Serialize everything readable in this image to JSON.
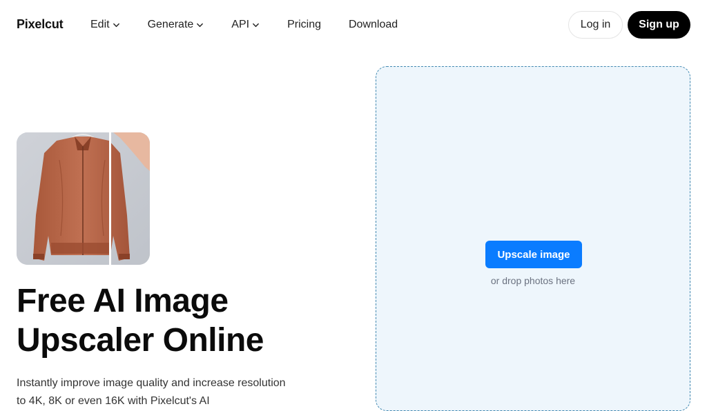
{
  "header": {
    "logo": "Pixelcut",
    "nav": [
      {
        "label": "Edit",
        "has_dropdown": true
      },
      {
        "label": "Generate",
        "has_dropdown": true
      },
      {
        "label": "API",
        "has_dropdown": true
      },
      {
        "label": "Pricing",
        "has_dropdown": false
      },
      {
        "label": "Download",
        "has_dropdown": false
      }
    ],
    "login_label": "Log in",
    "signup_label": "Sign up"
  },
  "hero": {
    "title_line1": "Free AI Image",
    "title_line2": "Upscaler Online",
    "description": "Instantly improve image quality and increase resolution to 4K, 8K or even 16K with Pixelcut's AI"
  },
  "dropzone": {
    "button_label": "Upscale image",
    "hint": "or drop photos here"
  },
  "colors": {
    "accent": "#0a7cff",
    "dropzone_bg": "#eef6fc",
    "dropzone_border": "#3f87b0",
    "signup_bg": "#000000"
  }
}
